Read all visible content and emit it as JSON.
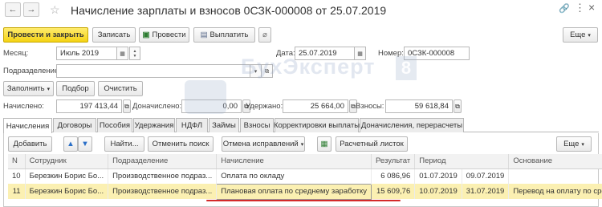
{
  "window": {
    "title": "Начисление зарплаты и взносов 0СЗК-000008 от 25.07.2019",
    "back_glyph": "←",
    "forward_glyph": "→",
    "star_glyph": "☆",
    "link_glyph": "🔗",
    "menu_glyph": "⋮",
    "close_glyph": "×"
  },
  "toolbar": {
    "post_close_label": "Провести и закрыть",
    "save_label": "Записать",
    "post_label": "Провести",
    "pay_label": "Выплатить",
    "more_label": "Еще"
  },
  "form": {
    "month_label": "Месяц:",
    "month_value": "Июль 2019",
    "date_label": "Дата:",
    "date_value": "25.07.2019",
    "number_label": "Номер:",
    "number_value": "0СЗК-000008",
    "department_label": "Подразделение:",
    "department_value": "",
    "fill_label": "Заполнить",
    "select_label": "Подбор",
    "clear_label": "Очистить",
    "accrued_label": "Начислено:",
    "accrued_value": "197 413,44",
    "additional_label": "Доначислено:",
    "additional_value": "0,00",
    "withheld_label": "Удержано:",
    "withheld_value": "25 664,00",
    "contributions_label": "Взносы:",
    "contributions_value": "59 618,84"
  },
  "tabs": [
    {
      "label": "Начисления",
      "active": true
    },
    {
      "label": "Договоры"
    },
    {
      "label": "Пособия"
    },
    {
      "label": "Удержания"
    },
    {
      "label": "НДФЛ"
    },
    {
      "label": "Займы"
    },
    {
      "label": "Взносы"
    },
    {
      "label": "Корректировки выплаты"
    },
    {
      "label": "Доначисления, перерасчеты"
    }
  ],
  "grid_toolbar": {
    "add_label": "Добавить",
    "find_label": "Найти...",
    "cancel_search_label": "Отменить поиск",
    "cancel_corrections_label": "Отмена исправлений",
    "payslip_label": "Расчетный листок",
    "more_label": "Еще"
  },
  "table": {
    "columns": [
      "N",
      "Сотрудник",
      "Подразделение",
      "Начисление",
      "Результат",
      "Период",
      "",
      "Основание"
    ],
    "rows": [
      {
        "n": "10",
        "employee": "Березкин Борис Бо...",
        "department": "Производственное подраз...",
        "accrual": "Оплата по окладу",
        "result": "6 086,96",
        "from": "01.07.2019",
        "to": "09.07.2019",
        "basis": ""
      },
      {
        "n": "11",
        "employee": "Березкин Борис Бо...",
        "department": "Производственное подраз...",
        "accrual": "Плановая оплата по среднему заработку",
        "result": "15 609,76",
        "from": "10.07.2019",
        "to": "31.07.2019",
        "basis": "Перевод на оплату по сре...",
        "selected": true
      }
    ]
  },
  "watermark": {
    "text": "БухЭксперт",
    "digit": "8"
  },
  "colors": {
    "primary_button": "#f5d314",
    "selected_row": "#fbf0b2",
    "highlight_underline": "#d42a2a"
  }
}
